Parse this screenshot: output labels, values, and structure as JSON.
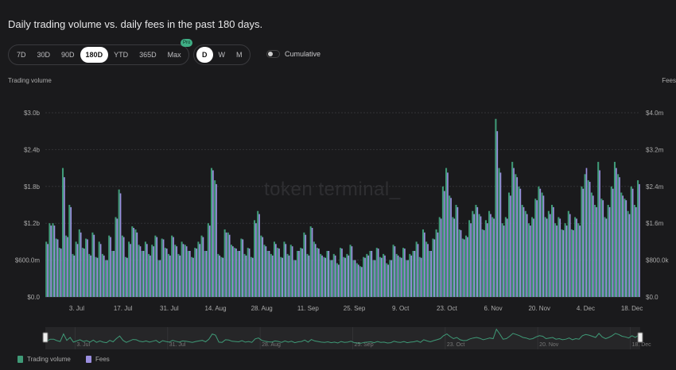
{
  "title": "Daily trading volume vs. daily fees in the past 180 days.",
  "ranges": [
    "7D",
    "30D",
    "90D",
    "180D",
    "YTD",
    "365D",
    "Max"
  ],
  "active_range": "180D",
  "pro_badge": "Pro",
  "granularity": [
    "D",
    "W",
    "M"
  ],
  "active_granularity": "D",
  "cumulative_label": "Cumulative",
  "cumulative_on": false,
  "watermark": "token terminal_",
  "colors": {
    "volume": "#3f9a77",
    "fees": "#9b8fe0",
    "line": "#3f9a77"
  },
  "chart_data": {
    "type": "bar",
    "title": "Daily trading volume vs. daily fees in the past 180 days.",
    "ylabel": "Trading volume",
    "y2label": "Fees",
    "ylim": [
      0,
      3000
    ],
    "y2lim": [
      0,
      4000
    ],
    "yticks": [
      "$0.0",
      "$600.0m",
      "$1.2b",
      "$1.8b",
      "$2.4b",
      "$3.0b"
    ],
    "y2ticks": [
      "$0.0",
      "$800.0k",
      "$1.6m",
      "$2.4m",
      "$3.2m",
      "$4.0m"
    ],
    "xticks": [
      "3. Jul",
      "17. Jul",
      "31. Jul",
      "14. Aug",
      "28. Aug",
      "11. Sep",
      "25. Sep",
      "9. Oct",
      "23. Oct",
      "6. Nov",
      "20. Nov",
      "4. Dec",
      "18. Dec"
    ],
    "xtick_day_index": [
      9,
      23,
      37,
      51,
      65,
      79,
      93,
      107,
      121,
      135,
      149,
      163,
      177
    ],
    "navigator_ticks": [
      "3. Jul",
      "31. Jul",
      "28. Aug",
      "25. Sep",
      "23. Oct",
      "20. Nov",
      "18. Dec"
    ],
    "navigator_tick_day_index": [
      9,
      37,
      65,
      93,
      121,
      149,
      177
    ],
    "legend": [
      "Trading volume",
      "Fees"
    ],
    "legend_position": "bottom-left",
    "grid": true,
    "series": [
      {
        "name": "Trading volume",
        "unit": "$m",
        "values": [
          900,
          1200,
          1200,
          950,
          800,
          2100,
          1000,
          1500,
          700,
          900,
          1100,
          800,
          950,
          700,
          1050,
          650,
          900,
          700,
          600,
          1000,
          750,
          1300,
          1750,
          1000,
          650,
          900,
          1150,
          1100,
          850,
          750,
          900,
          700,
          850,
          1000,
          600,
          950,
          800,
          700,
          1000,
          850,
          700,
          900,
          850,
          750,
          650,
          800,
          900,
          1000,
          750,
          1200,
          2100,
          1900,
          700,
          650,
          1100,
          1050,
          850,
          800,
          750,
          950,
          700,
          800,
          650,
          1250,
          1400,
          1000,
          850,
          750,
          700,
          900,
          800,
          650,
          900,
          700,
          850,
          600,
          750,
          800,
          1050,
          700,
          1150,
          900,
          800,
          700,
          650,
          750,
          600,
          700,
          550,
          800,
          650,
          700,
          850,
          600,
          550,
          500,
          650,
          700,
          750,
          600,
          800,
          650,
          700,
          550,
          600,
          850,
          700,
          650,
          800,
          600,
          700,
          750,
          900,
          650,
          1100,
          900,
          750,
          950,
          1100,
          1300,
          1800,
          2100,
          1650,
          1300,
          1500,
          1100,
          950,
          1000,
          1250,
          1400,
          1500,
          1350,
          1100,
          1250,
          1400,
          1300,
          2900,
          2100,
          1200,
          1300,
          1700,
          2200,
          2000,
          1800,
          1500,
          1400,
          1200,
          1300,
          1600,
          1800,
          1700,
          1300,
          1400,
          1500,
          1200,
          1300,
          1100,
          1200,
          1400,
          1100,
          1300,
          1200,
          1800,
          2000,
          1900,
          1700,
          1500,
          2200,
          1600,
          1300,
          1500,
          1800,
          2200,
          2000,
          1700,
          1600,
          1400,
          1800,
          1500,
          1900
        ]
      },
      {
        "name": "Fees",
        "unit": "$k",
        "values": [
          1150,
          1550,
          1550,
          1250,
          1050,
          2600,
          1300,
          1950,
          900,
          1150,
          1400,
          1050,
          1250,
          900,
          1350,
          850,
          1150,
          900,
          800,
          1300,
          1000,
          1700,
          2250,
          1300,
          850,
          1150,
          1500,
          1400,
          1100,
          1000,
          1150,
          900,
          1100,
          1300,
          800,
          1250,
          1050,
          900,
          1300,
          1100,
          900,
          1150,
          1100,
          1000,
          850,
          1050,
          1150,
          1300,
          1000,
          1550,
          2750,
          2450,
          900,
          850,
          1400,
          1350,
          1100,
          1050,
          1000,
          1250,
          900,
          1050,
          850,
          1600,
          1800,
          1300,
          1100,
          1000,
          900,
          1150,
          1050,
          850,
          1150,
          900,
          1100,
          800,
          1000,
          1050,
          1350,
          900,
          1500,
          1150,
          1050,
          900,
          850,
          1000,
          800,
          900,
          700,
          1050,
          850,
          900,
          1100,
          800,
          700,
          650,
          850,
          900,
          1000,
          800,
          1050,
          850,
          900,
          700,
          800,
          1100,
          900,
          850,
          1050,
          800,
          900,
          1000,
          1150,
          850,
          1400,
          1150,
          1000,
          1250,
          1400,
          1700,
          2300,
          2700,
          2150,
          1700,
          1950,
          1450,
          1250,
          1300,
          1600,
          1800,
          1950,
          1750,
          1450,
          1600,
          1800,
          1700,
          3600,
          2700,
          1550,
          1700,
          2200,
          2800,
          2600,
          2350,
          1950,
          1800,
          1550,
          1700,
          2100,
          2350,
          2200,
          1700,
          1800,
          1950,
          1550,
          1700,
          1450,
          1550,
          1800,
          1450,
          1700,
          1550,
          2350,
          2800,
          2500,
          2200,
          1950,
          2750,
          2100,
          1700,
          1950,
          2350,
          2800,
          2600,
          2200,
          2100,
          1800,
          2350,
          1950,
          2450
        ]
      }
    ]
  }
}
